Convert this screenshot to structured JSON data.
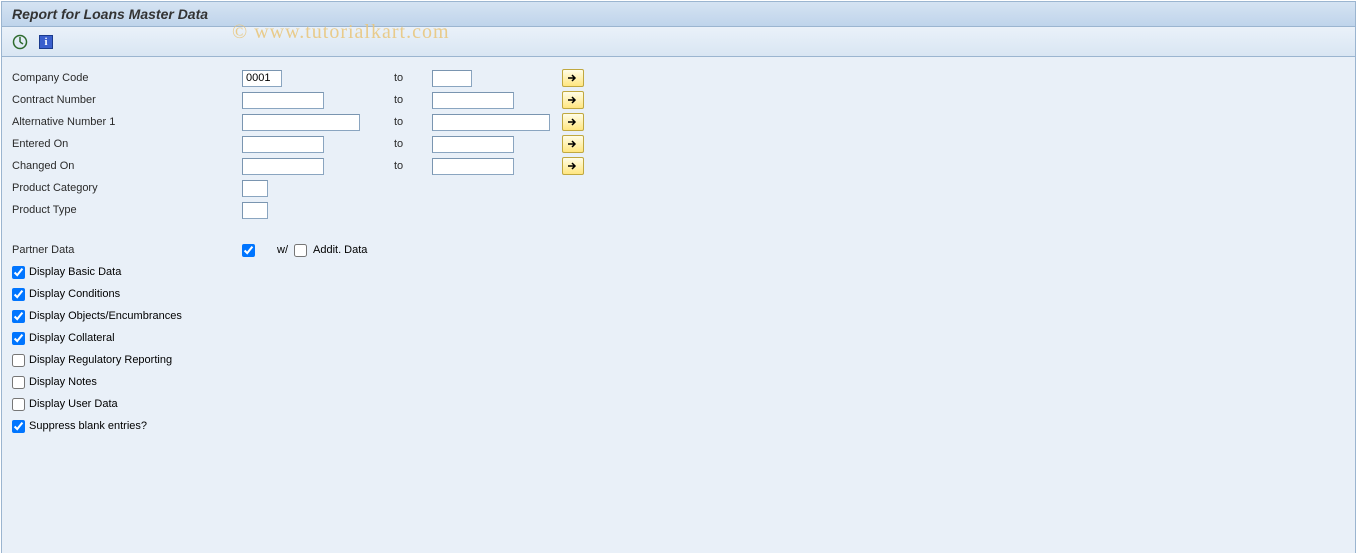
{
  "title": "Report for Loans Master Data",
  "watermark": "© www.tutorialkart.com",
  "fields": {
    "company_code": {
      "label": "Company Code",
      "from": "0001",
      "to_label": "to",
      "to": ""
    },
    "contract_number": {
      "label": "Contract Number",
      "from": "",
      "to_label": "to",
      "to": ""
    },
    "alt_number1": {
      "label": "Alternative Number 1",
      "from": "",
      "to_label": "to",
      "to": ""
    },
    "entered_on": {
      "label": "Entered On",
      "from": "",
      "to_label": "to",
      "to": ""
    },
    "changed_on": {
      "label": "Changed On",
      "from": "",
      "to_label": "to",
      "to": ""
    },
    "product_category": {
      "label": "Product Category",
      "value": ""
    },
    "product_type": {
      "label": "Product Type",
      "value": ""
    }
  },
  "partner": {
    "label": "Partner Data",
    "w_label": "w/",
    "addit_label": "Addit. Data"
  },
  "checks": {
    "basic": "Display Basic Data",
    "conditions": "Display Conditions",
    "objects": "Display Objects/Encumbrances",
    "collateral": "Display Collateral",
    "regulatory": "Display Regulatory Reporting",
    "notes": "Display Notes",
    "userdata": "Display User Data",
    "suppress": "Suppress blank entries?"
  }
}
